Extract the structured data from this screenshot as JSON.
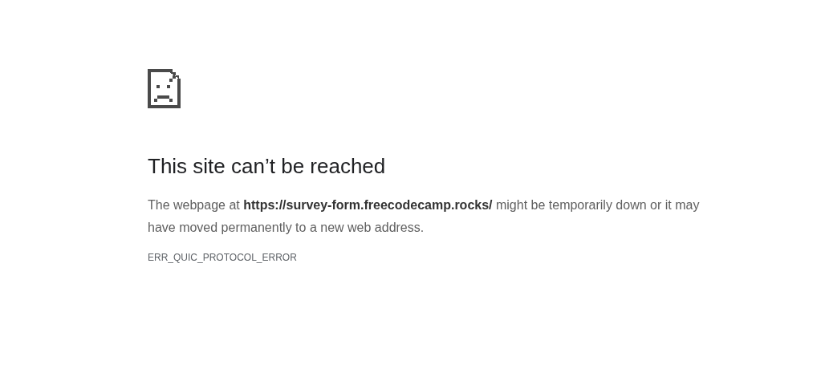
{
  "heading": "This site can’t be reached",
  "message": "The webpage at **https://survey-form.freecodecamp.rocks/** might be temporarily down or it may have moved permanently to a new web address.",
  "error_code": "ERR_QUIC_PROTOCOL_ERROR"
}
